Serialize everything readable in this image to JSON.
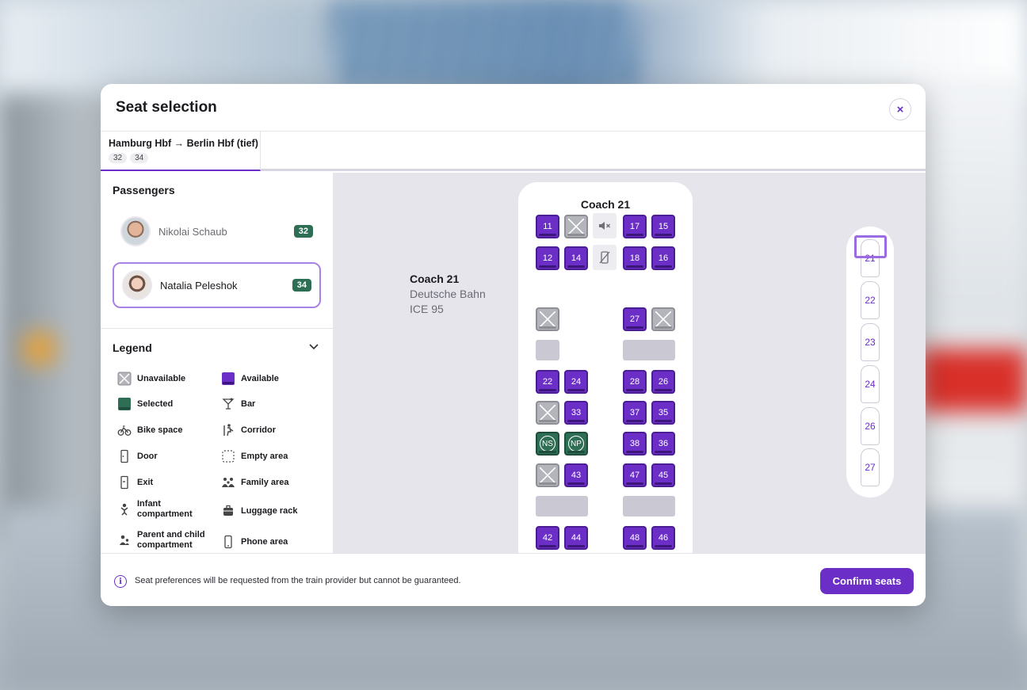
{
  "modal": {
    "title": "Seat selection",
    "close_label": "×"
  },
  "tab": {
    "label": "Hamburg Hbf → Berlin Hbf (tief)",
    "chips": [
      "32",
      "34"
    ]
  },
  "passengers": {
    "title": "Passengers",
    "items": [
      {
        "name": "Nikolai Schaub",
        "seat": "32"
      },
      {
        "name": "Natalia Peleshok",
        "seat": "34"
      }
    ]
  },
  "legend": {
    "title": "Legend",
    "items": [
      {
        "label": "Unavailable",
        "icon": "unavailable-seat-icon"
      },
      {
        "label": "Available",
        "icon": "available-seat-icon"
      },
      {
        "label": "Selected",
        "icon": "selected-seat-icon"
      },
      {
        "label": "Bar",
        "icon": "cocktail-icon"
      },
      {
        "label": "Bike space",
        "icon": "bike-icon"
      },
      {
        "label": "Corridor",
        "icon": "corridor-icon"
      },
      {
        "label": "Door",
        "icon": "door-icon"
      },
      {
        "label": "Empty area",
        "icon": "empty-area-icon"
      },
      {
        "label": "Exit",
        "icon": "exit-icon"
      },
      {
        "label": "Family area",
        "icon": "family-icon"
      },
      {
        "label": "Infant compartment",
        "icon": "infant-icon"
      },
      {
        "label": "Luggage rack",
        "icon": "luggage-icon"
      },
      {
        "label": "Parent and child compartment",
        "icon": "parent-child-icon"
      },
      {
        "label": "Phone area",
        "icon": "phone-icon"
      }
    ]
  },
  "coach": {
    "title": "Coach 21",
    "operator": "Deutsche Bahn",
    "train": "ICE 95"
  },
  "seats": {
    "s11": "11",
    "s17": "17",
    "s15": "15",
    "s12": "12",
    "s14": "14",
    "s18": "18",
    "s16": "16",
    "s27": "27",
    "s22": "22",
    "s24": "24",
    "s28": "28",
    "s26": "26",
    "s33": "33",
    "s37": "37",
    "s35": "35",
    "pref_ns": "NS",
    "pref_np": "NP",
    "s38": "38",
    "s36": "36",
    "s43": "43",
    "s47": "47",
    "s45": "45",
    "s42": "42",
    "s44": "44",
    "s48": "48",
    "s46": "46"
  },
  "coach_nav": [
    "21",
    "22",
    "23",
    "24",
    "26",
    "27"
  ],
  "footer": {
    "info": "Seat preferences will be requested from the train provider but cannot be guaranteed.",
    "confirm_label": "Confirm seats"
  },
  "colors": {
    "accent": "#6b2fc7",
    "selected": "#2e6e55",
    "unavailable": "#b4b4bb"
  }
}
